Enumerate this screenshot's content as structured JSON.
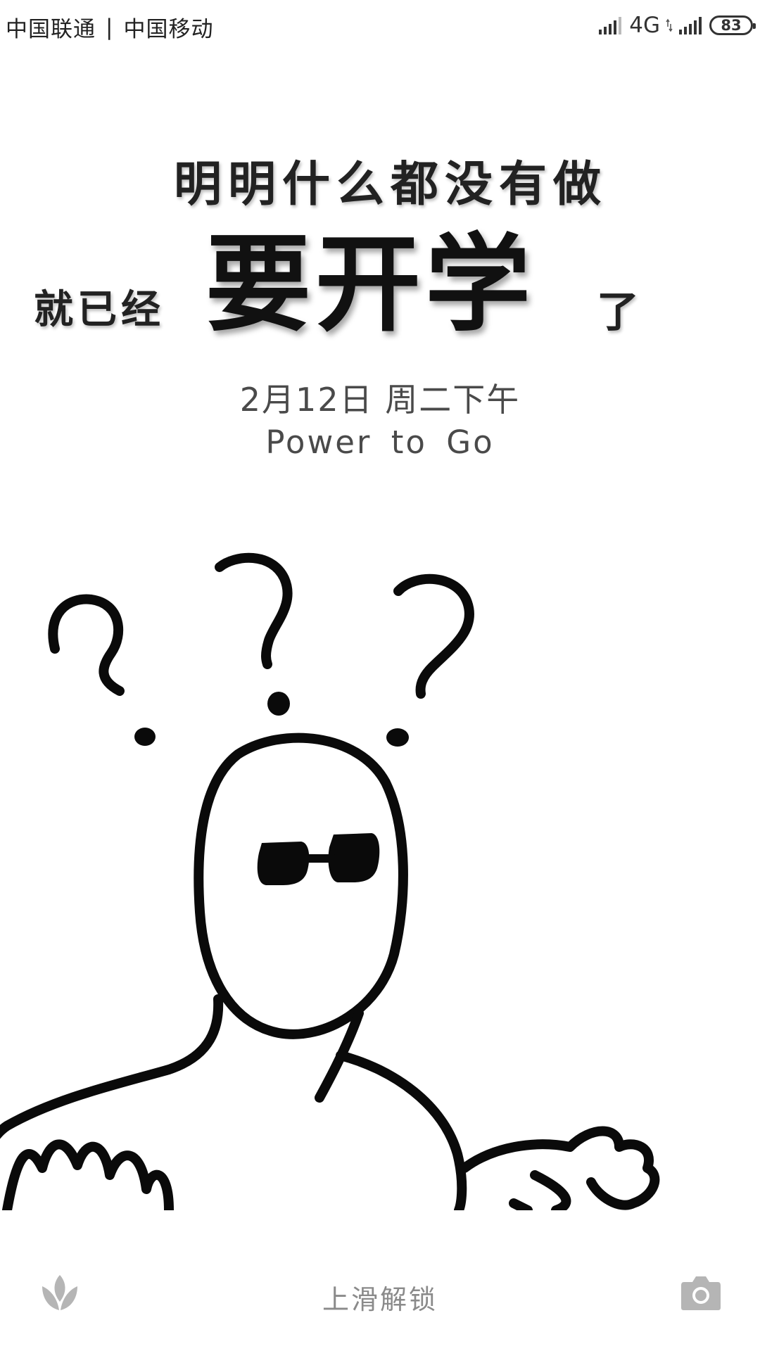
{
  "status_bar": {
    "carrier_1": "中国联通",
    "separator": "|",
    "carrier_2": "中国移动",
    "network": "4G",
    "battery_level": "83"
  },
  "wallpaper": {
    "headline_line1": "明明什么都没有做",
    "headline_prefix": "就已经",
    "headline_main": "要开学",
    "headline_suffix": "了"
  },
  "lockscreen": {
    "date": "2月12日  周二下午",
    "slogan": "Power to Go",
    "unlock_hint": "上滑解锁"
  },
  "icons": {
    "left_shortcut": "flower-icon",
    "right_shortcut": "camera-icon",
    "signal": "signal-bars-icon"
  },
  "colors": {
    "background": "#ffffff",
    "text_dark": "#222222",
    "text_muted": "#8a8a8a",
    "icon_gray": "#b5b5b5"
  }
}
